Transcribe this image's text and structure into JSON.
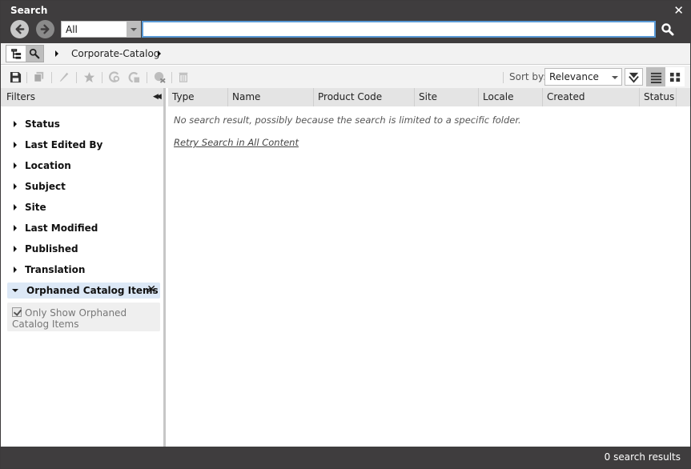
{
  "window": {
    "title": "Search",
    "close_label": "✕"
  },
  "search": {
    "scope_value": "All",
    "query_value": "",
    "query_placeholder": ""
  },
  "breadcrumb": {
    "items": [
      "Corporate-Catalog"
    ]
  },
  "toolbar": {
    "icons": [
      "save-icon",
      "copy-icon",
      "edit-icon",
      "favorite-icon",
      "refresh-icon",
      "checkout-icon",
      "unpublish-icon",
      "delete-icon"
    ],
    "sort_label": "Sort by:",
    "sort_value": "Relevance"
  },
  "filters": {
    "header": "Filters",
    "collapse_label": "◀◀",
    "items": [
      {
        "label": "Status",
        "expanded": false
      },
      {
        "label": "Last Edited By",
        "expanded": false
      },
      {
        "label": "Location",
        "expanded": false
      },
      {
        "label": "Subject",
        "expanded": false
      },
      {
        "label": "Site",
        "expanded": false
      },
      {
        "label": "Last Modified",
        "expanded": false
      },
      {
        "label": "Published",
        "expanded": false
      },
      {
        "label": "Translation",
        "expanded": false
      },
      {
        "label": "Orphaned Catalog Items",
        "expanded": true
      }
    ],
    "remove_label": "✕",
    "option": {
      "label": "Only Show Orphaned Catalog Items",
      "checked": true
    }
  },
  "results": {
    "columns": [
      "Type",
      "Name",
      "Product Code",
      "Site",
      "Locale",
      "Created",
      "Status"
    ],
    "empty_message": "No search result, possibly because the search is limited to a specific folder.",
    "retry_link": "Retry Search in All Content"
  },
  "footer": {
    "count_text": "0 search results"
  },
  "colors": {
    "header_bg": "#3f3d3e",
    "accent": "#5a9ad6",
    "selected_filter_bg": "#dce8f6"
  }
}
